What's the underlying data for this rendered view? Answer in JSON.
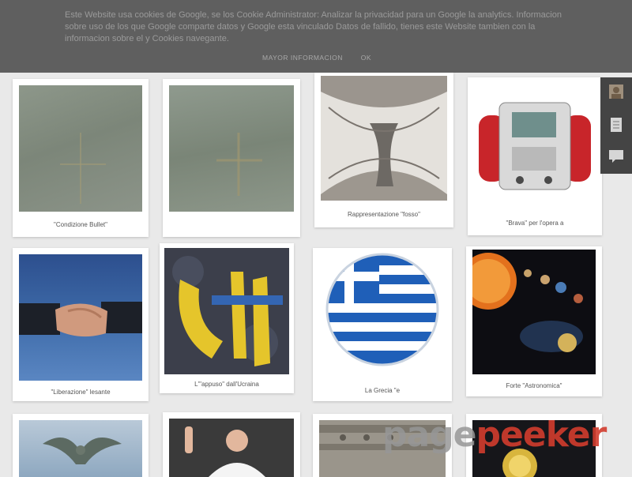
{
  "cookie_banner": {
    "text": "Este Website usa cookies de Google, se los Cookie Administrator: Analizar la privacidad para un Google la analytics. Informacion sobre uso de los que Google comparte datos y Google esta vinculado Datos de fallido, tienes este Website tambien con la informacion sobre el y Cookies navegante.",
    "more_label": "MAYOR INFORMACION",
    "ok_label": "OK",
    "background": "#5f5f5f"
  },
  "gallery": {
    "cards": [
      {
        "caption": "\"Condizione Bullet\"",
        "image": "concrete-wall"
      },
      {
        "caption": "",
        "image": "concrete-wall-cross"
      },
      {
        "caption": "Rappresentazione \"fosso\"",
        "image": "sculpture-sketch"
      },
      {
        "caption": "\"Brava\" per l'opera a",
        "image": "red-medical-device"
      },
      {
        "caption": "\"Liberazione\" lesante",
        "image": "handshake"
      },
      {
        "caption": "L'\"appuso\" dall'Ucraina",
        "image": "crowd-flag"
      },
      {
        "caption": "La Grecia \"e",
        "image": "greek-flag"
      },
      {
        "caption": "Forte \"Astronomica\"",
        "image": "solar-system"
      },
      {
        "caption": "",
        "image": "angel-statue"
      },
      {
        "caption": "",
        "image": "pope-waving"
      },
      {
        "caption": "",
        "image": "stone-relief"
      },
      {
        "caption": "",
        "image": "dark-sphere"
      }
    ]
  },
  "sidebar": {
    "buttons": [
      "avatar-icon",
      "document-icon",
      "comment-icon"
    ]
  },
  "watermark": {
    "part1": "page",
    "part2": "peeker"
  },
  "colors": {
    "page_bg": "#e9e9e9",
    "accent_red": "#d23c2d"
  }
}
